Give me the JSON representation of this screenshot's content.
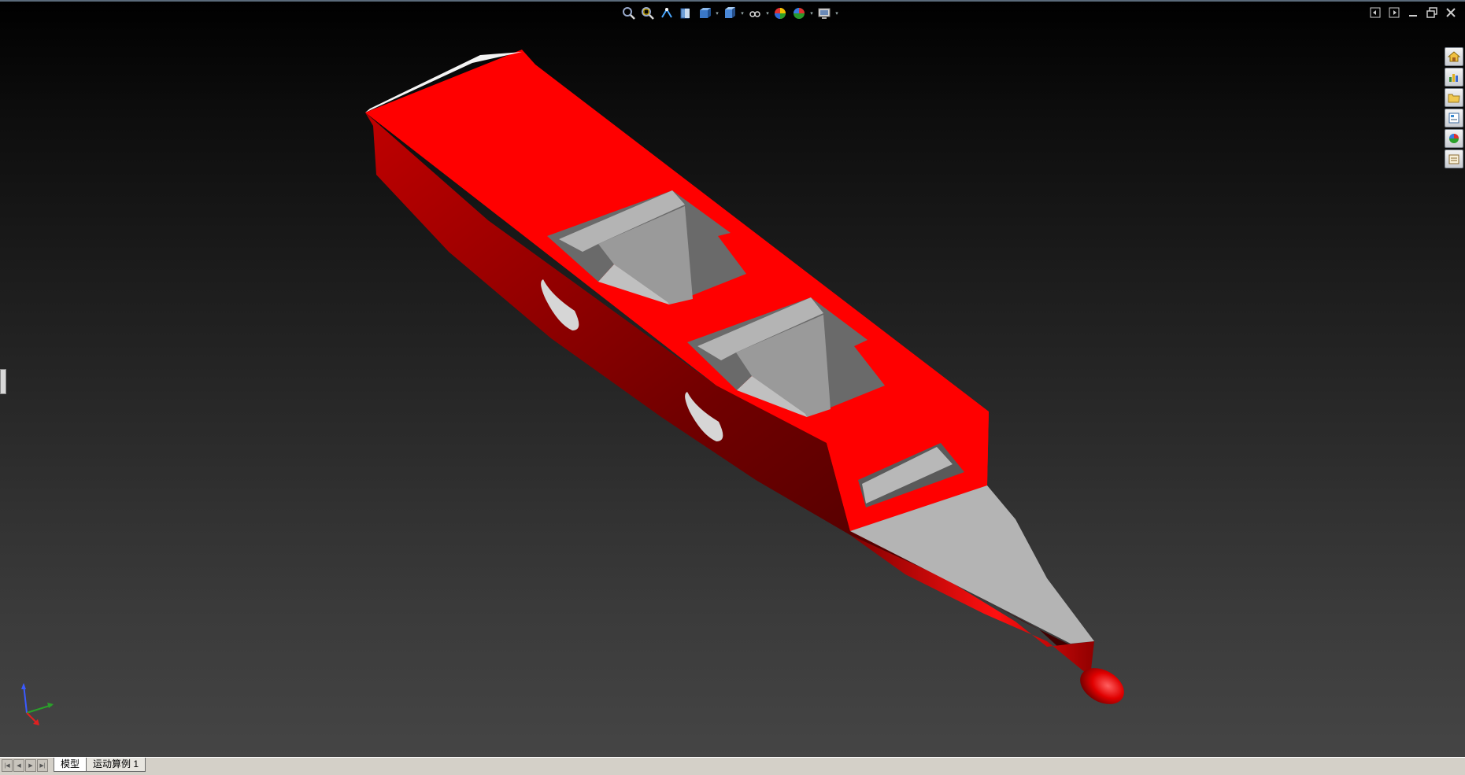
{
  "viewport": {
    "heads_up_toolbar": [
      {
        "icon": "zoom-to-fit-icon"
      },
      {
        "icon": "zoom-to-area-icon"
      },
      {
        "icon": "previous-view-icon"
      },
      {
        "icon": "section-view-icon"
      },
      {
        "icon": "view-orientation-icon",
        "dropdown": true
      },
      {
        "icon": "display-style-icon",
        "dropdown": true
      },
      {
        "icon": "hide-show-items-icon",
        "dropdown": true
      },
      {
        "icon": "edit-appearance-icon"
      },
      {
        "icon": "apply-scene-icon",
        "dropdown": true
      },
      {
        "icon": "view-settings-icon",
        "dropdown": true
      }
    ],
    "window_controls": [
      "tile-left-icon",
      "tile-right-icon",
      "minimize-icon",
      "restore-icon",
      "close-icon"
    ],
    "task_pane": [
      "home-icon",
      "resources-icon",
      "file-explorer-icon",
      "view-palette-icon",
      "appearances-icon",
      "custom-properties-icon"
    ],
    "model_colors": {
      "hull": "#ff0000",
      "interior": "#b4b4b4",
      "background_top": "#000000",
      "background_bottom": "#454545"
    }
  },
  "statusbar": {
    "nav_arrows": [
      "first-icon",
      "prev-icon",
      "next-icon",
      "last-icon"
    ],
    "tabs": [
      {
        "label": "模型",
        "active": true
      },
      {
        "label": "运动算例 1",
        "active": false
      }
    ]
  }
}
